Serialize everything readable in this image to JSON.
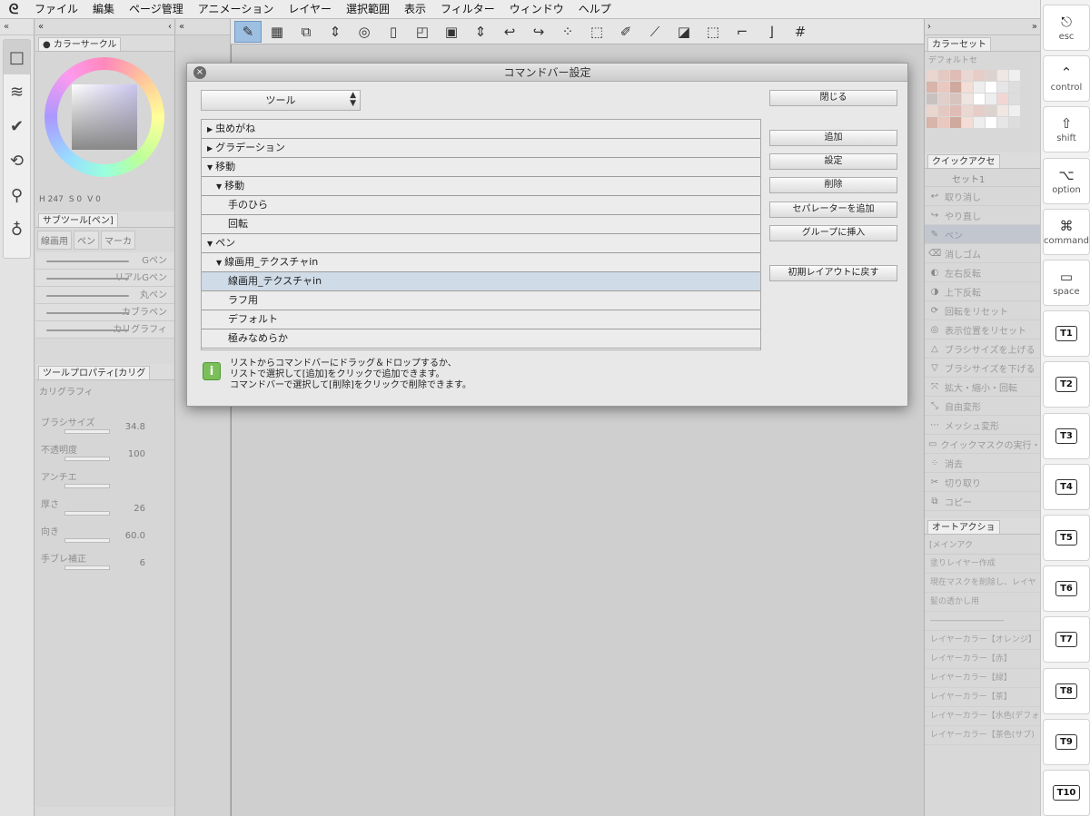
{
  "menu": {
    "logo": "ᘓ",
    "items": [
      "ファイル",
      "編集",
      "ページ管理",
      "アニメーション",
      "レイヤー",
      "選択範囲",
      "表示",
      "フィルター",
      "ウィンドウ",
      "ヘルプ"
    ]
  },
  "left_tools": [
    "□",
    "≋",
    "✔",
    "⟲",
    "⚲",
    "♁"
  ],
  "color_circle": {
    "tab": "カラーサークル",
    "h": "247",
    "s": "0",
    "v": "0"
  },
  "subtool": {
    "tab": "サブツール[ペン]",
    "tabs": [
      "線画用",
      "ペン",
      "マーカ"
    ],
    "brushes": [
      "Gペン",
      "リアルGペン",
      "丸ペン",
      "カブラペン",
      "カリグラフィ"
    ]
  },
  "tool_property": {
    "tab": "ツールプロパティ[カリグ",
    "brush_name": "カリグラフィ",
    "props": [
      {
        "label": "ブラシサイズ",
        "value": "34.8"
      },
      {
        "label": "不透明度",
        "value": "100"
      },
      {
        "label": "アンチエ",
        "value": ""
      },
      {
        "label": "厚さ",
        "value": "26"
      },
      {
        "label": "向き",
        "value": "60.0"
      },
      {
        "label": "手ブレ補正",
        "value": "6"
      }
    ]
  },
  "command_bar": {
    "icons": [
      "✎",
      "▦",
      "⧉",
      "⇕",
      "◎",
      "▯",
      "◰",
      "▣",
      "⇕",
      "↩",
      "↪",
      "⁘",
      "⬚",
      "✐",
      "⟋",
      "◪",
      "⬚",
      "⌐",
      "⌋",
      "#"
    ]
  },
  "right": {
    "color_set": {
      "tab": "カラーセット",
      "preset": "デフォルトセ"
    },
    "quick_access": {
      "tab": "クイックアクセ",
      "set": "セット1",
      "items": [
        "取り消し",
        "やり直し",
        "ペン",
        "消しゴム",
        "左右反転",
        "上下反転",
        "回転をリセット",
        "表示位置をリセット",
        "ブラシサイズを上げる",
        "ブラシサイズを下げる",
        "拡大・縮小・回転",
        "自由変形",
        "メッシュ変形",
        "クイックマスクの実行・",
        "消去",
        "切り取り",
        "コピー"
      ]
    },
    "auto_action": {
      "tab": "オートアクショ",
      "set": "[メインアク",
      "items": [
        "塗りレイヤー作成",
        "現在マスクを削除し、レイヤ",
        "髪の透かし用",
        "―――――――――",
        "レイヤーカラー【オレンジ】",
        "レイヤーカラー【赤】",
        "レイヤーカラー【緑】",
        "レイヤーカラー【茶】",
        "レイヤーカラー【水色(デフォ",
        "レイヤーカラー【茶色(サブ)"
      ]
    }
  },
  "keys": [
    {
      "icon": "⎋",
      "label": "esc"
    },
    {
      "icon": "⌃",
      "label": "control"
    },
    {
      "icon": "⇧",
      "label": "shift"
    },
    {
      "icon": "⌥",
      "label": "option"
    },
    {
      "icon": "⌘",
      "label": "command"
    },
    {
      "icon": "▭",
      "label": "space"
    },
    {
      "icon": "",
      "label": "T1"
    },
    {
      "icon": "",
      "label": "T2"
    },
    {
      "icon": "",
      "label": "T3"
    },
    {
      "icon": "",
      "label": "T4"
    },
    {
      "icon": "",
      "label": "T5"
    },
    {
      "icon": "",
      "label": "T6"
    },
    {
      "icon": "",
      "label": "T7"
    },
    {
      "icon": "",
      "label": "T8"
    },
    {
      "icon": "",
      "label": "T9"
    },
    {
      "icon": "",
      "label": "T10"
    }
  ],
  "dialog": {
    "title": "コマンドバー設定",
    "close_glyph": "×",
    "category": "ツール",
    "rows": [
      {
        "label": "虫めがね",
        "level": 0,
        "open": false
      },
      {
        "label": "グラデーション",
        "level": 0,
        "open": false
      },
      {
        "label": "移動",
        "level": 0,
        "open": true
      },
      {
        "label": "移動",
        "level": 1,
        "open": true
      },
      {
        "label": "手のひら",
        "level": 2
      },
      {
        "label": "回転",
        "level": 2
      },
      {
        "label": "ペン",
        "level": 0,
        "open": true
      },
      {
        "label": "線画用_テクスチャin",
        "level": 1,
        "open": true
      },
      {
        "label": "線画用_テクスチャin",
        "level": 2,
        "selected": true
      },
      {
        "label": "ラフ用",
        "level": 2
      },
      {
        "label": "デフォルト",
        "level": 2
      },
      {
        "label": "極みなめらか",
        "level": 2
      }
    ],
    "buttons": {
      "close": "閉じる",
      "add": "追加",
      "settings": "設定",
      "delete": "削除",
      "add_separator": "セパレーターを追加",
      "insert_group": "グループに挿入",
      "reset_layout": "初期レイアウトに戻す"
    },
    "info_icon": "i",
    "info_lines": [
      "リストからコマンドバーにドラッグ＆ドロップするか、",
      "リストで選択して[追加]をクリックで追加できます。",
      "コマンドバーで選択して[削除]をクリックで削除できます。"
    ]
  }
}
